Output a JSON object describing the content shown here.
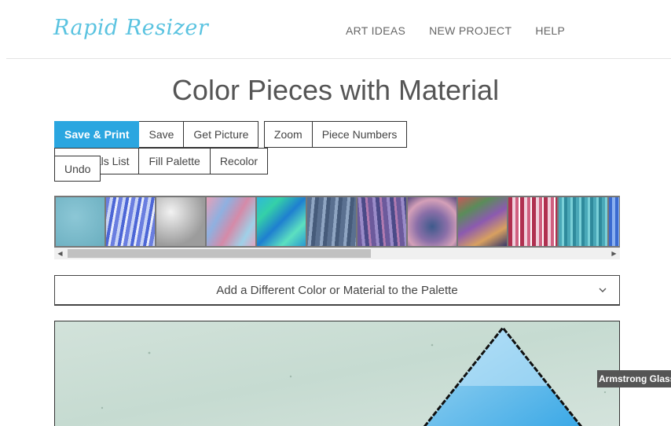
{
  "header": {
    "logo_text": "Rapid Resizer",
    "nav": [
      "ART IDEAS",
      "NEW PROJECT",
      "HELP"
    ]
  },
  "page": {
    "title": "Color Pieces with Material"
  },
  "toolbar": {
    "save_print": "Save & Print",
    "save": "Save",
    "get_picture": "Get Picture",
    "zoom": "Zoom",
    "piece_numbers": "Piece Numbers",
    "materials_list": "Materials List",
    "fill_palette": "Fill Palette",
    "recolor": "Recolor",
    "undo": "Undo"
  },
  "palette": {
    "swatch_count": 12,
    "scroll_position": 0.0
  },
  "dropdown": {
    "label": "Add a Different Color or Material to the Palette"
  },
  "tooltip": {
    "text": "Armstrong Glass"
  },
  "colors": {
    "accent": "#2aa6e0",
    "logo": "#5ac3e0",
    "canvas_bg": "#cfe0d7",
    "triangle_fill": "#7cc6ee"
  }
}
